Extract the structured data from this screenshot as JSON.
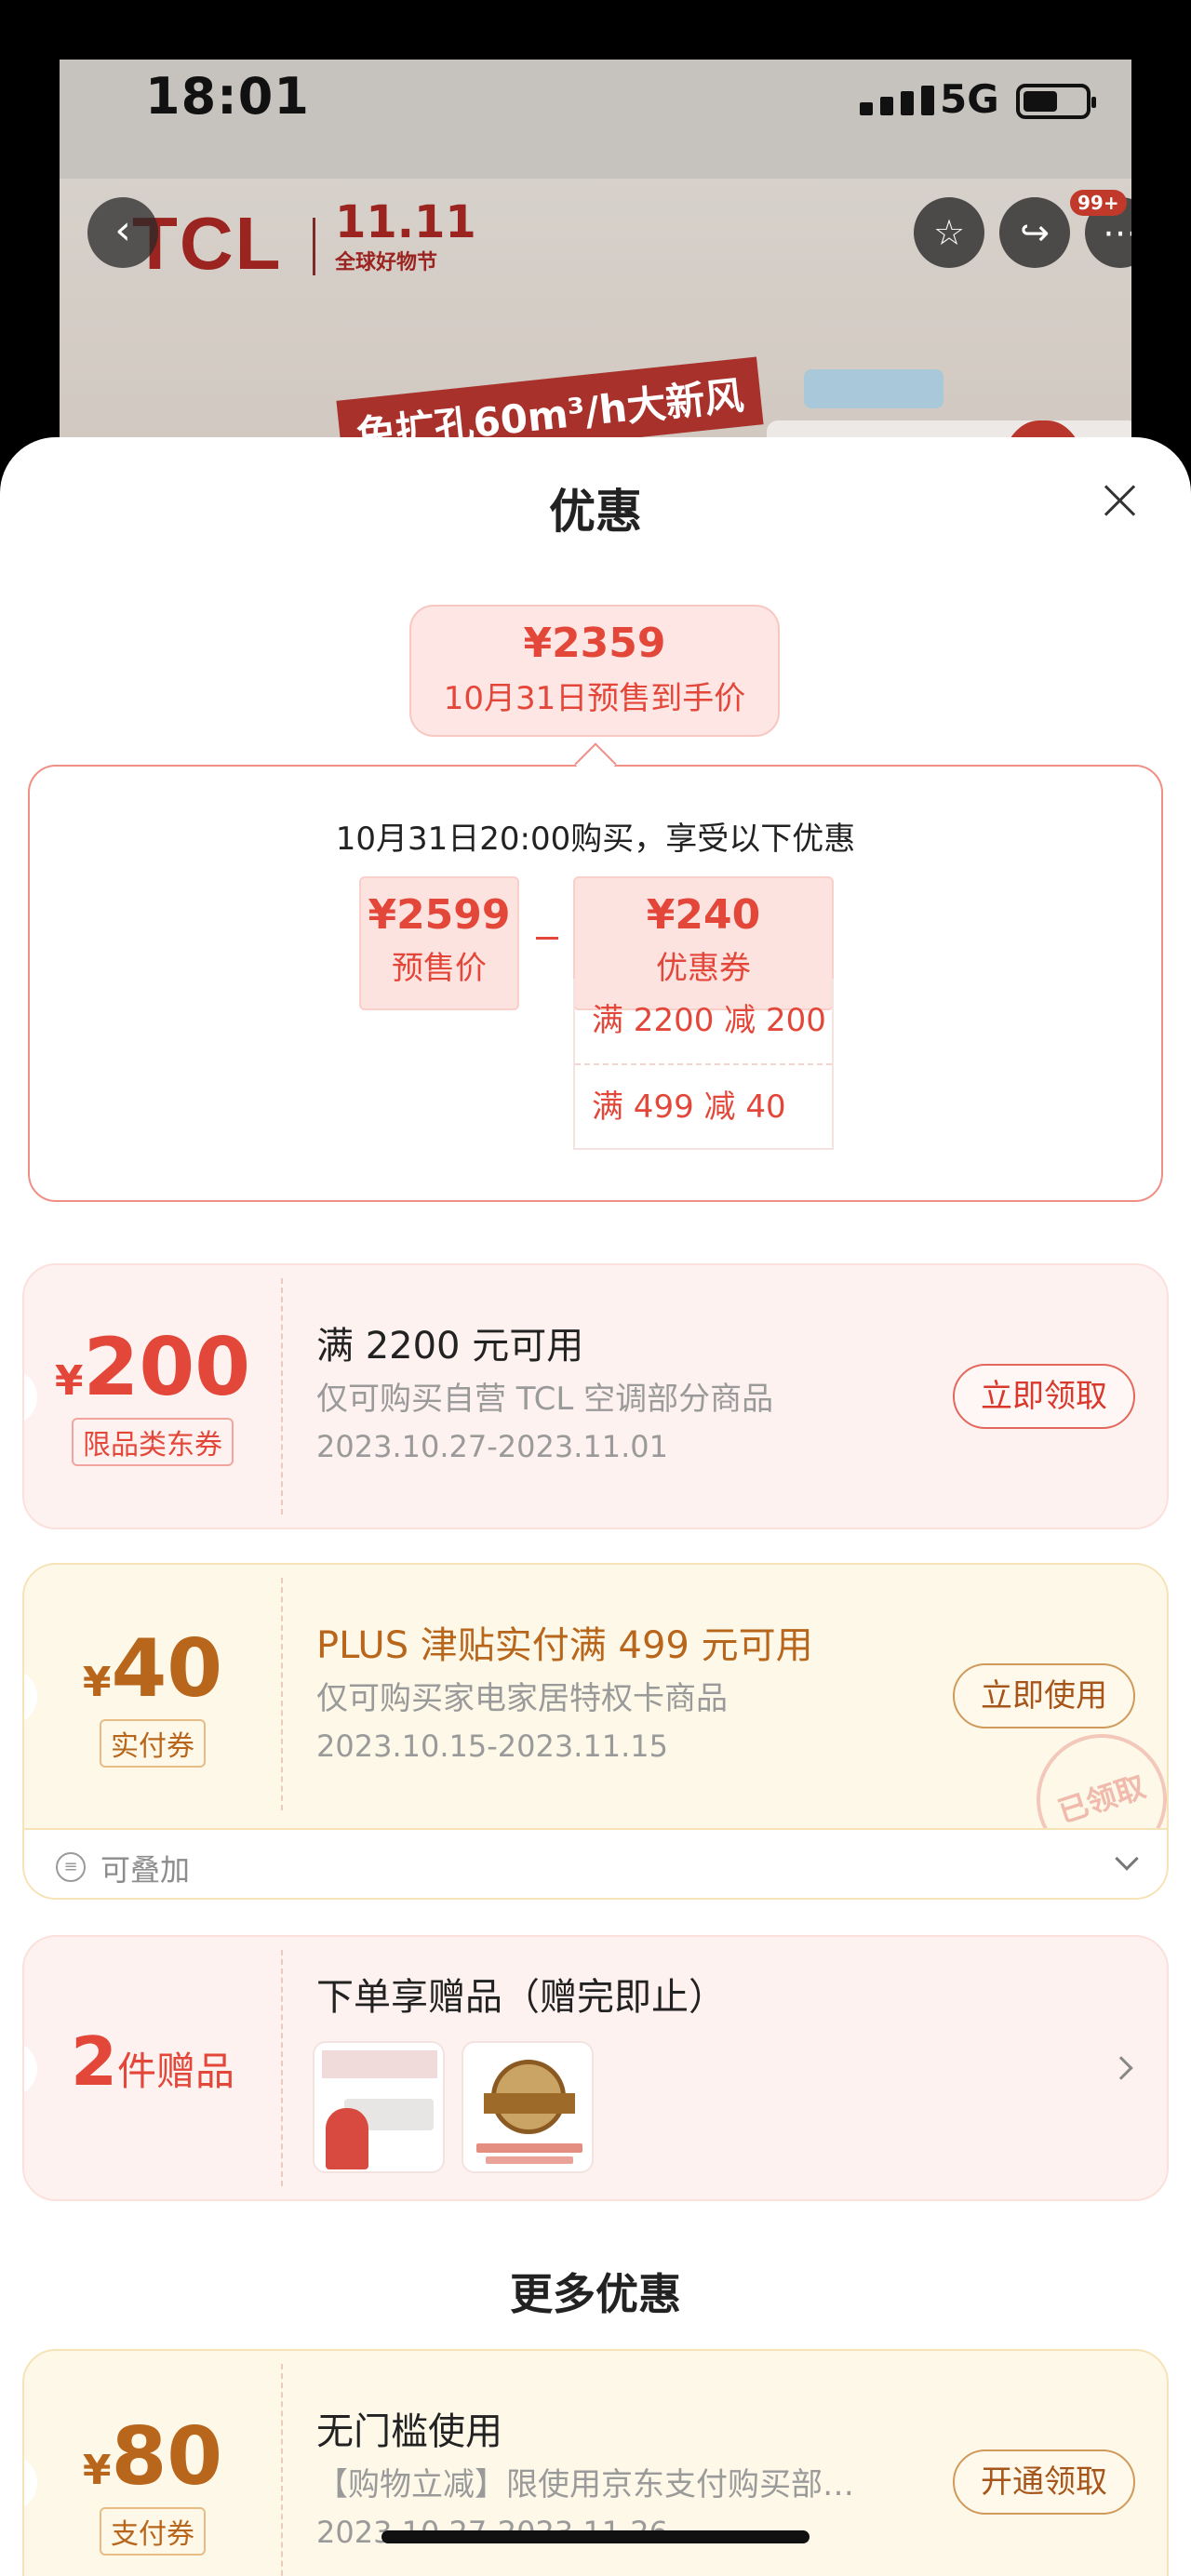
{
  "status_bar": {
    "time": "18:01",
    "network": "5G"
  },
  "background": {
    "brand": "TCL",
    "event_logo": "11.11",
    "event_sub": "全球好物节",
    "slogan": "免扩孔60m³/h大新风",
    "cart_badge": "99+"
  },
  "sheet": {
    "title": "优惠",
    "final_price": "¥2359",
    "final_price_note": "10月31日预售到手价",
    "detail_heading": "10月31日20:00购买，享受以下优惠",
    "presale_price": "¥2599",
    "presale_label": "预售价",
    "coupon_total": "¥240",
    "coupon_total_label": "优惠券",
    "conditions": [
      "满 2200 减 200",
      "满 499 减 40"
    ]
  },
  "coupons": [
    {
      "currency": "¥",
      "amount": "200",
      "tag": "限品类东券",
      "title": "满 2200 元可用",
      "subtitle": "仅可购买自营 TCL 空调部分商品",
      "dates": "2023.10.27-2023.11.01",
      "button": "立即领取"
    },
    {
      "currency": "¥",
      "amount": "40",
      "tag": "实付券",
      "title": "PLUS 津贴实付满 499 元可用",
      "subtitle": "仅可购买家电家居特权卡商品",
      "dates": "2023.10.15-2023.11.15",
      "button": "立即使用",
      "stamp": "已领取",
      "stack_label": "可叠加"
    }
  ],
  "gift": {
    "count": "2",
    "unit": "件赠品",
    "title": "下单享赠品（赠完即止）"
  },
  "more_section": {
    "title": "更多优惠",
    "coupon": {
      "currency": "¥",
      "amount": "80",
      "tag": "支付券",
      "title": "无门槛使用",
      "subtitle": "【购物立减】限使用京东支付购买部…",
      "dates": "2023.10.27-2023.11.26",
      "button": "开通领取"
    }
  },
  "colors": {
    "accent_red": "#e3473a",
    "accent_gold": "#b8661c"
  }
}
